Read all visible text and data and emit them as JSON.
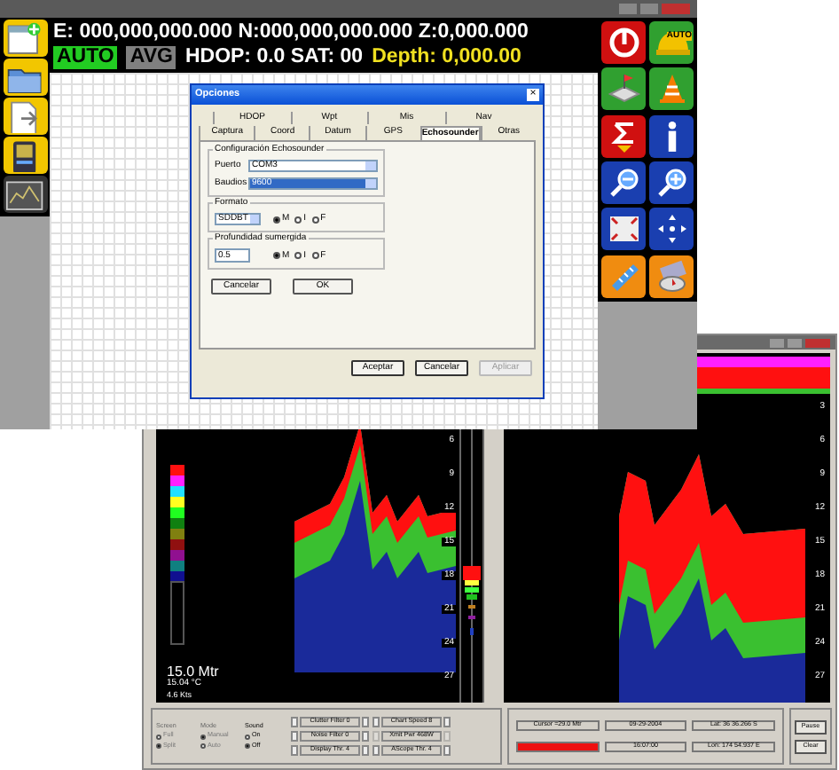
{
  "gps_window": {
    "left_tools": [
      {
        "kind": "new"
      },
      {
        "kind": "folder"
      },
      {
        "kind": "export"
      },
      {
        "kind": "device"
      },
      {
        "kind": "chart"
      }
    ],
    "coordinates": "E: 000,000,000.000 N:000,000,000.000 Z:0,000.000",
    "modes": [
      {
        "label": "AUTO",
        "on": true
      },
      {
        "label": "AVG",
        "on": false
      }
    ],
    "gps_status": "HDOP: 0.0  SAT: 00",
    "depth": "Depth: 0,000.00",
    "right_tools": [
      {
        "kind": "power",
        "color": "#d01010"
      },
      {
        "kind": "helmet",
        "color": "#30a030",
        "label": "AUTO"
      },
      {
        "kind": "map",
        "color": "#30a030"
      },
      {
        "kind": "cone",
        "color": "#30a030"
      },
      {
        "kind": "sigma",
        "color": "#d01010"
      },
      {
        "kind": "info",
        "color": "#1a3fb0"
      },
      {
        "kind": "zoom_out",
        "color": "#1a3fb0"
      },
      {
        "kind": "zoom_in",
        "color": "#1a3fb0"
      },
      {
        "kind": "fit",
        "color": "#1a3fb0"
      },
      {
        "kind": "pan",
        "color": "#1a3fb0"
      },
      {
        "kind": "ruler",
        "color": "#f08c10"
      },
      {
        "kind": "compass",
        "color": "#f08c10"
      }
    ],
    "dialog": {
      "title": "Opciones",
      "close": "×",
      "tabs_back": [
        {
          "label": "HDOP",
          "selected": false
        },
        {
          "label": "Wpt",
          "selected": false
        },
        {
          "label": "Mis",
          "selected": false
        },
        {
          "label": "Nav",
          "selected": false
        }
      ],
      "tabs_front": [
        {
          "label": "Captura",
          "selected": false
        },
        {
          "label": "Coord",
          "selected": false
        },
        {
          "label": "Datum",
          "selected": false
        },
        {
          "label": "GPS",
          "selected": false
        },
        {
          "label": "Echosounder",
          "selected": true
        },
        {
          "label": "Otras",
          "selected": false
        }
      ],
      "config_group": "Configuración Echosounder",
      "port": {
        "label": "Puerto",
        "value": "COM3"
      },
      "baud": {
        "label": "Baudios",
        "value": "9600",
        "highlighted": true
      },
      "format": {
        "group": "Formato",
        "value": "SDDBT",
        "units": [
          {
            "label": "M",
            "selected": true
          },
          {
            "label": "I",
            "selected": false
          },
          {
            "label": "F",
            "selected": false
          }
        ]
      },
      "draft": {
        "group": "Profundidad sumergida",
        "value": "0.5",
        "units": [
          {
            "label": "M",
            "selected": true
          },
          {
            "label": "I",
            "selected": false
          },
          {
            "label": "F",
            "selected": false
          }
        ]
      },
      "inner_buttons": [
        "Cancelar",
        "OK"
      ],
      "buttons": [
        {
          "label": "Aceptar",
          "disabled": false
        },
        {
          "label": "Cancelar",
          "disabled": false
        },
        {
          "label": "Aplicar",
          "disabled": true
        }
      ]
    }
  },
  "sonar_window": {
    "left_depths": [
      "6",
      "9",
      "12",
      "15",
      "18",
      "21",
      "24",
      "27"
    ],
    "right_depths": [
      "3",
      "6",
      "9",
      "12",
      "15",
      "18",
      "21",
      "24",
      "27"
    ],
    "depth_reading": "15.0 Mtr",
    "temperature": "15.04 °C",
    "speed": "4.6 Kts",
    "radio_groups": [
      {
        "title": "Screen",
        "disabled": true,
        "options": [
          {
            "label": "Full",
            "selected": false
          },
          {
            "label": "Split",
            "selected": true
          }
        ]
      },
      {
        "title": "Mode",
        "disabled": true,
        "options": [
          {
            "label": "Manual",
            "selected": true
          },
          {
            "label": "Auto",
            "selected": false
          }
        ]
      },
      {
        "title": "Sound",
        "disabled": false,
        "options": [
          {
            "label": "On",
            "selected": false
          },
          {
            "label": "Off",
            "selected": true
          }
        ]
      }
    ],
    "steppers": [
      {
        "label": "Clutter Filter 0",
        "arrows": true
      },
      {
        "label": "Noise Filter 0",
        "arrows": true
      },
      {
        "label": "Display Thr. 4",
        "arrows": true
      },
      {
        "label": "Chart Speed 8",
        "arrows": true
      },
      {
        "label": "Xmit Pwr 468W",
        "arrows": false
      },
      {
        "label": "AScope Thr. 4",
        "arrows": true
      }
    ],
    "readouts": [
      {
        "text": "Cursor =29.0 Mtr",
        "alert": false
      },
      {
        "text": "09-29-2004",
        "alert": false
      },
      {
        "text": "Lat: 36 36.266 S",
        "alert": false
      },
      {
        "alert": true
      },
      {
        "text": "16:07:00",
        "alert": false
      },
      {
        "text": "Lon: 174 54.937 E",
        "alert": false
      }
    ],
    "buttons": [
      "Pause",
      "Clear"
    ]
  }
}
